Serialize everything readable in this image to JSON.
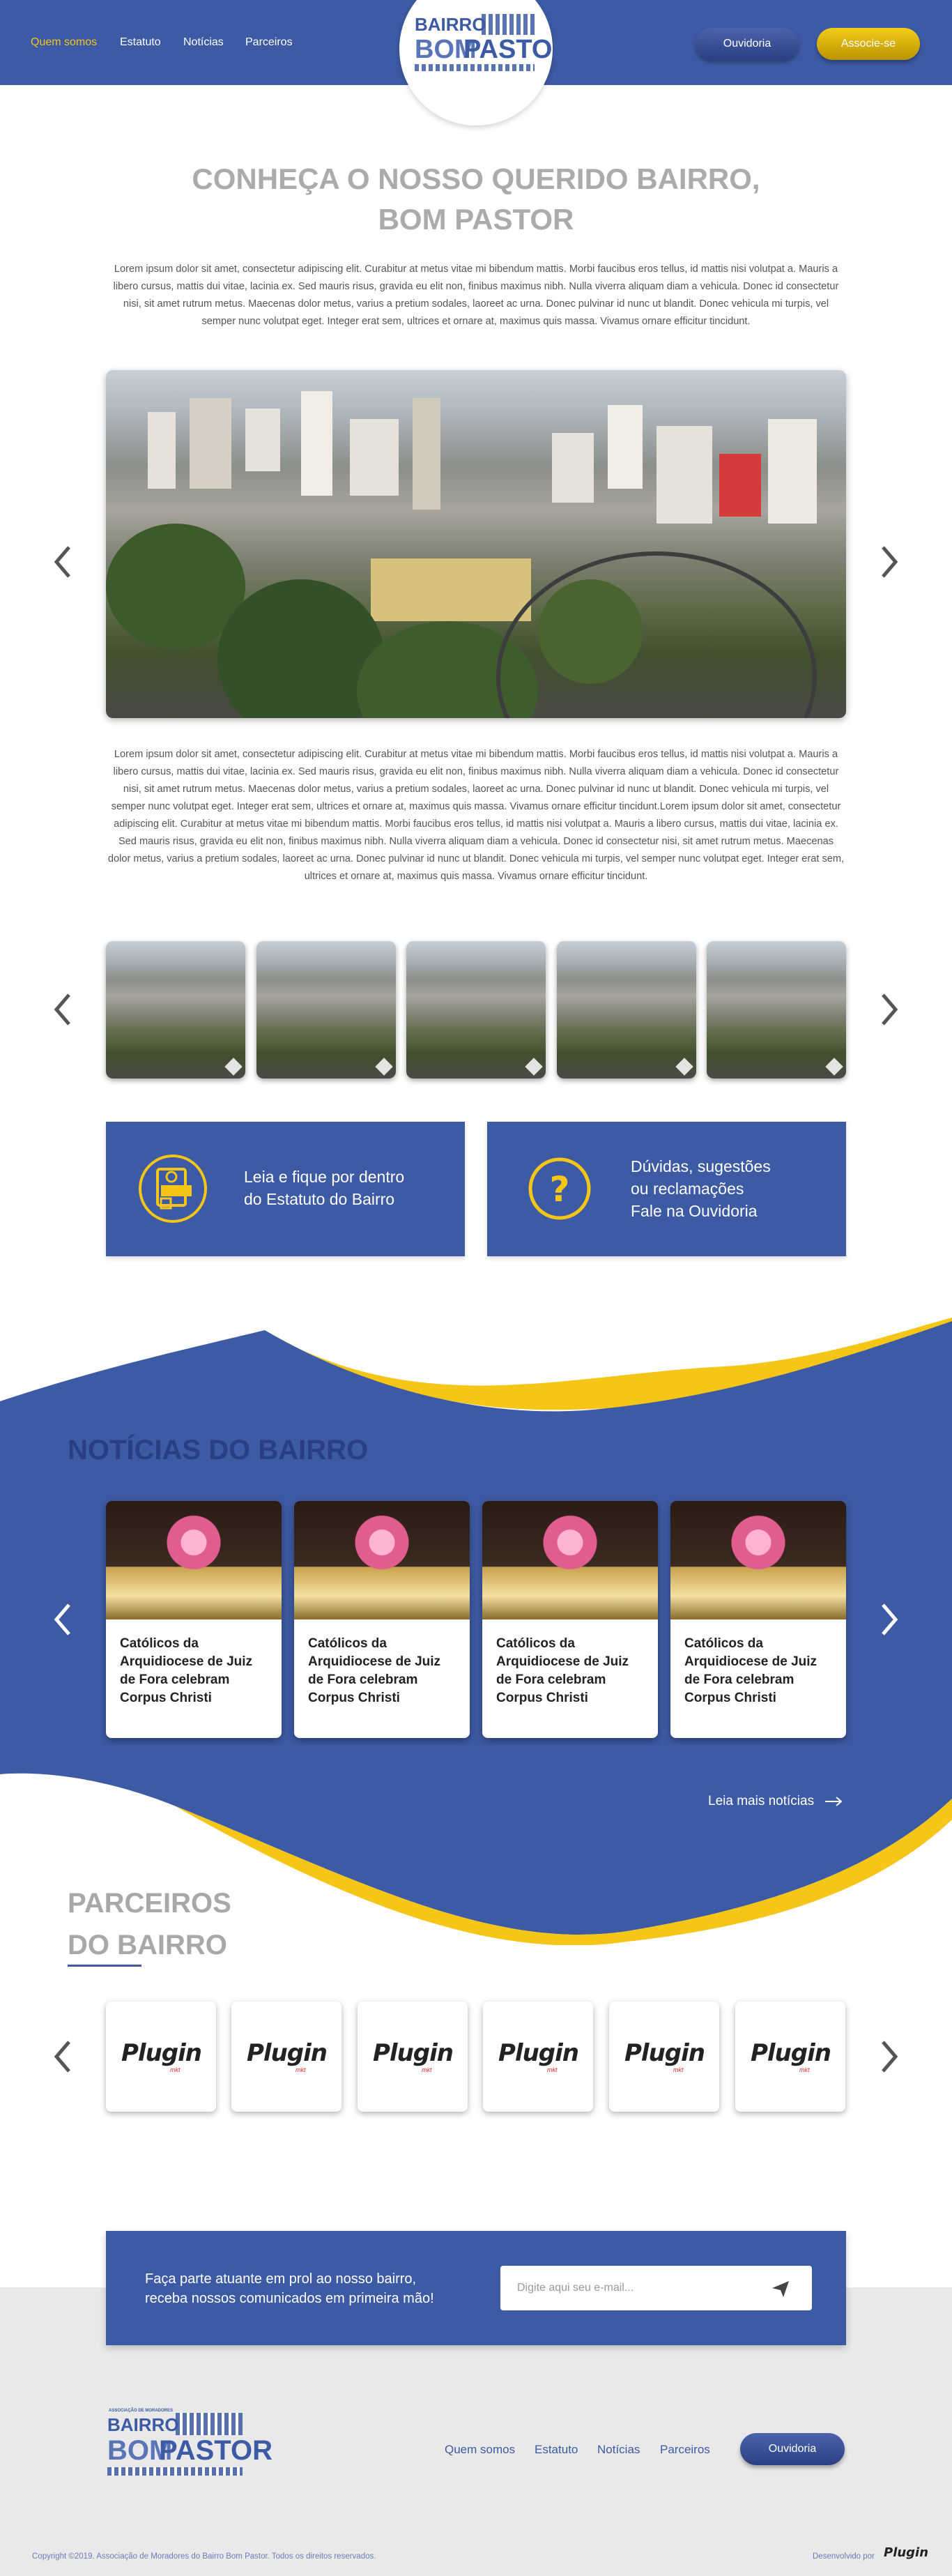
{
  "header": {
    "nav": [
      "Quem somos",
      "Estatuto",
      "Notícias",
      "Parceiros"
    ],
    "logo_line1": "BAIRRO",
    "logo_line2": "BOM",
    "logo_line3": "PASTOR",
    "ouvidoria_label": "Ouvidoria",
    "associe_label": "Associe-se"
  },
  "hero": {
    "title_line1": "CONHEÇA O NOSSO QUERIDO BAIRRO,",
    "title_line2": "BOM PASTOR",
    "intro": "Lorem ipsum dolor sit amet, consectetur adipiscing elit. Curabitur at metus vitae mi bibendum mattis. Morbi faucibus eros tellus, id mattis nisi volutpat a. Mauris a libero cursus, mattis dui vitae, lacinia ex. Sed mauris risus, gravida eu elit non, finibus maximus nibh. Nulla viverra aliquam diam a vehicula. Donec id consectetur nisi, sit amet rutrum metus. Maecenas dolor metus, varius a pretium sodales, laoreet ac urna. Donec pulvinar id nunc ut blandit. Donec vehicula mi turpis, vel semper nunc volutpat eget. Integer erat sem, ultrices et ornare at, maximus quis massa. Vivamus ornare efficitur tincidunt.",
    "body": "Lorem ipsum dolor sit amet, consectetur adipiscing elit. Curabitur at metus vitae mi bibendum mattis. Morbi faucibus eros tellus, id mattis nisi volutpat a. Mauris a libero cursus, mattis dui vitae, lacinia ex. Sed mauris risus, gravida eu elit non, finibus maximus nibh. Nulla viverra aliquam diam a vehicula. Donec id consectetur nisi, sit amet rutrum metus. Maecenas dolor metus, varius a pretium sodales, laoreet ac urna. Donec pulvinar id nunc ut blandit. Donec vehicula mi turpis, vel semper nunc volutpat eget. Integer erat sem, ultrices et ornare at, maximus quis massa. Vivamus ornare efficitur tincidunt.Lorem ipsum dolor sit amet, consectetur adipiscing elit. Curabitur at metus vitae mi bibendum mattis. Morbi faucibus eros tellus, id mattis nisi volutpat a. Mauris a libero cursus, mattis dui vitae, lacinia ex. Sed mauris risus, gravida eu elit non, finibus maximus nibh. Nulla viverra aliquam diam a vehicula. Donec id consectetur nisi, sit amet rutrum metus. Maecenas dolor metus, varius a pretium sodales, laoreet ac urna. Donec pulvinar id nunc ut blandit. Donec vehicula mi turpis, vel semper nunc volutpat eget. Integer erat sem, ultrices et ornare at, maximus quis massa. Vivamus ornare efficitur tincidunt."
  },
  "cta": {
    "estatuto_line1": "Leia e fique por dentro",
    "estatuto_line2": "do Estatuto do Bairro",
    "ouvidoria_line1": "Dúvidas, sugestões",
    "ouvidoria_line2": "ou reclamações",
    "ouvidoria_line3": "Fale na Ouvidoria"
  },
  "news": {
    "title": "NOTÍCIAS DO BAIRRO",
    "items": [
      {
        "title": "Católicos da Arquidiocese de Juiz de Fora celebram Corpus Christi"
      },
      {
        "title": "Católicos da Arquidiocese de Juiz de Fora celebram Corpus Christi"
      },
      {
        "title": "Católicos da Arquidiocese de Juiz de Fora celebram Corpus Christi"
      },
      {
        "title": "Católicos da Arquidiocese de Juiz de Fora celebram Corpus Christi"
      }
    ],
    "more_label": "Leia mais notícias"
  },
  "partners": {
    "title_line1": "PARCEIROS",
    "title_line2": "DO BAIRRO",
    "logo_text": "Plugin",
    "logo_sub": "mkt"
  },
  "newsletter": {
    "text_line1": "Faça parte atuante em prol ao nosso bairro,",
    "text_line2": "receba nossos comunicados em primeira mão!",
    "placeholder": "Digite aqui seu e-mail..."
  },
  "footer": {
    "logo_small": "ASSOCIAÇÃO DE MORADORES",
    "nav": [
      "Quem somos",
      "Estatuto",
      "Notícias",
      "Parceiros"
    ],
    "ouvidoria_label": "Ouvidoria",
    "copyright": "Copyright ©2019. Associação de Moradores do Bairro Bom Pastor. Todos os direitos reservados.",
    "developed_by": "Desenvolvido por",
    "developer": "Plugin"
  },
  "colors": {
    "primary": "#3d5aa4",
    "accent": "#f5c518",
    "footer_bg": "#e9e9e9"
  }
}
